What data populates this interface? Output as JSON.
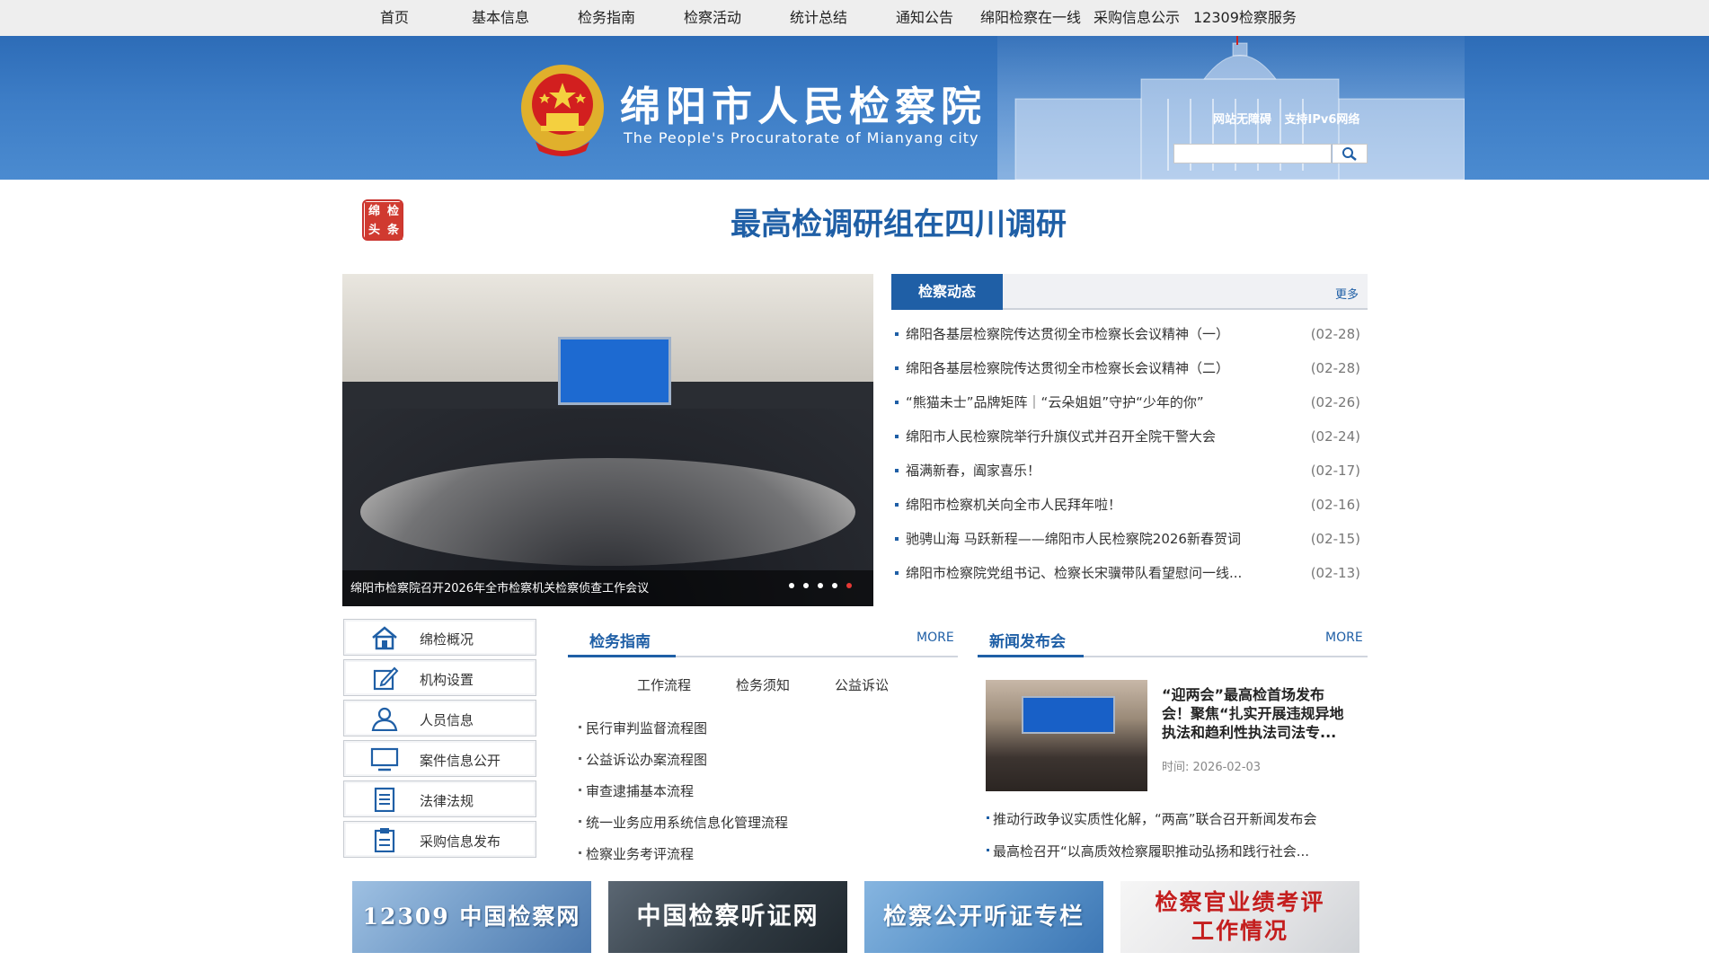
{
  "nav": {
    "items": [
      "首页",
      "基本信息",
      "检务指南",
      "检察活动",
      "统计总结",
      "通知公告",
      "绵阳检察在一线",
      "采购信息公示",
      "12309检察服务"
    ]
  },
  "header": {
    "title": "绵阳市人民检察院",
    "subtitle": "The People's Procuratorate of Mianyang city",
    "link_accessible": "网站无障碍",
    "link_ipv6": "支持IPv6网络",
    "search_placeholder": ""
  },
  "headline": {
    "badge": [
      "绵",
      "检",
      "头",
      "条"
    ],
    "text": "最高检调研组在四川调研"
  },
  "slideshow": {
    "caption": "绵阳市检察院召开2026年全市检察机关检察侦查工作会议",
    "dot_count": 5,
    "active_dot": 5
  },
  "news": {
    "tab": "检察动态",
    "more": "更多",
    "items": [
      {
        "title": "绵阳各基层检察院传达贯彻全市检察长会议精神（一）",
        "date": "(02-28)"
      },
      {
        "title": "绵阳各基层检察院传达贯彻全市检察长会议精神（二）",
        "date": "(02-28)"
      },
      {
        "title": "“熊猫未士”品牌矩阵｜“云朵姐姐”守护“少年的你”",
        "date": "(02-26)"
      },
      {
        "title": "绵阳市人民检察院举行升旗仪式并召开全院干警大会",
        "date": "(02-24)"
      },
      {
        "title": "福满新春，阖家喜乐！",
        "date": "(02-17)"
      },
      {
        "title": "绵阳市检察机关向全市人民拜年啦！",
        "date": "(02-16)"
      },
      {
        "title": "驰骋山海 马跃新程——绵阳市人民检察院2026新春贺词",
        "date": "(02-15)"
      },
      {
        "title": "绵阳市检察院党组书记、检察长宋骥带队看望慰问一线...",
        "date": "(02-13)"
      }
    ]
  },
  "sidebar": {
    "items": [
      {
        "label": "绵检概况",
        "icon": "home-icon"
      },
      {
        "label": "机构设置",
        "icon": "edit-icon"
      },
      {
        "label": "人员信息",
        "icon": "user-icon"
      },
      {
        "label": "案件信息公开",
        "icon": "monitor-icon"
      },
      {
        "label": "法律法规",
        "icon": "document-icon"
      },
      {
        "label": "采购信息发布",
        "icon": "clipboard-icon"
      }
    ]
  },
  "guide": {
    "title": "检务指南",
    "more": "MORE",
    "tabs": [
      "工作流程",
      "检务须知",
      "公益诉讼"
    ],
    "items": [
      "民行审判监督流程图",
      "公益诉讼办案流程图",
      "审查逮捕基本流程",
      "统一业务应用系统信息化管理流程",
      "检察业务考评流程"
    ]
  },
  "press": {
    "title": "新闻发布会",
    "more": "MORE",
    "feature_title": "“迎两会”最高检首场发布会！聚焦“扎实开展违规异地执法和趋利性执法司法专...",
    "feature_time": "时间: 2026-02-03",
    "items": [
      "推动行政争议实质性化解，“两高”联合召开新闻发布会",
      "最高检召开“以高质效检察履职推动弘扬和践行社会..."
    ]
  },
  "banners": [
    {
      "text": "12309 中国检察网",
      "bg": "#7fa6cf"
    },
    {
      "text": "中国检察听证网",
      "bg": "#3a4650"
    },
    {
      "text": "检察公开听证专栏",
      "bg": "#5a93c9"
    },
    {
      "text": "检察官业绩考评\n工作情况",
      "bg": "#e9e9ea"
    }
  ],
  "colors": {
    "brand_blue": "#1f5fa6",
    "header_blue": "#3d7dc6",
    "accent_red": "#e53935"
  }
}
